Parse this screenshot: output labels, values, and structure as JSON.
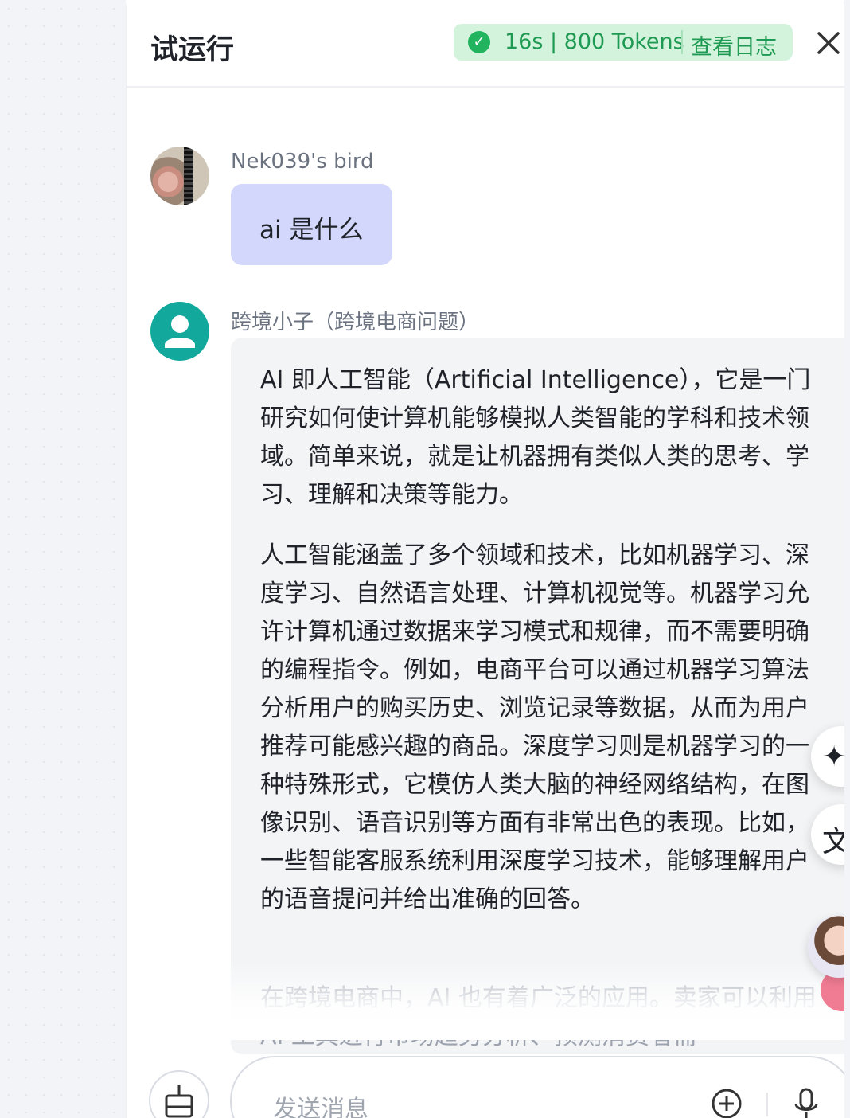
{
  "panel": {
    "title": "试运行",
    "status": {
      "text": "16s | 800 Tokens",
      "log_label": "查看日志"
    }
  },
  "messages": {
    "user": {
      "name": "Nek039's bird",
      "text": "ai 是什么"
    },
    "bot": {
      "name": "跨境小子（跨境电商问题）",
      "paragraphs": [
        "AI 即人工智能（Artificial Intelligence），它是一门研究如何使计算机能够模拟人类智能的学科和技术领域。简单来说，就是让机器拥有类似人类的思考、学习、理解和决策等能力。",
        "人工智能涵盖了多个领域和技术，比如机器学习、深度学习、自然语言处理、计算机视觉等。机器学习允许计算机通过数据来学习模式和规律，而不需要明确的编程指令。例如，电商平台可以通过机器学习算法分析用户的购买历史、浏览记录等数据，从而为用户推荐可能感兴趣的商品。深度学习则是机器学习的一种特殊形式，它模仿人类大脑的神经网络结构，在图像识别、语音识别等方面有非常出色的表现。比如，一些智能客服系统利用深度学习技术，能够理解用户的语音提问并给出准确的回答。",
        "在跨境电商中，AI 也有着广泛的应用。卖家可以利用 AI 工具进行市场趋势分析、预测消费者需"
      ]
    }
  },
  "input": {
    "placeholder": "发送消息"
  },
  "floating": {
    "sparkle_glyph": "✦",
    "translate_glyph": "文"
  },
  "colors": {
    "status_green": "#1f9a52",
    "user_bubble": "#d2d7fb",
    "bot_avatar": "#12a89c"
  }
}
